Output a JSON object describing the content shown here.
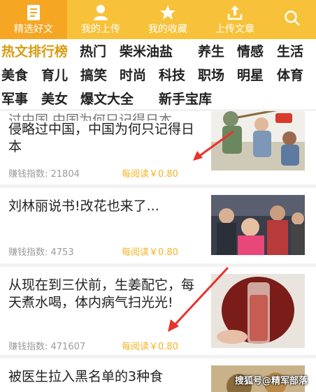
{
  "nav": {
    "items": [
      {
        "label": "精选好文",
        "icon": "article-icon",
        "active": true
      },
      {
        "label": "我的上传",
        "icon": "user-icon",
        "active": false
      },
      {
        "label": "我的收藏",
        "icon": "star-icon",
        "active": false
      },
      {
        "label": "上传文章",
        "icon": "upload-icon",
        "active": false
      },
      {
        "label": "",
        "icon": "search-icon",
        "active": false
      }
    ]
  },
  "categories": {
    "row1": [
      "热文排行榜",
      "热门",
      "柴米油盐",
      "养生",
      "情感",
      "生活"
    ],
    "row2": [
      "美食",
      "育儿",
      "搞笑",
      "时尚",
      "科技",
      "职场",
      "明星",
      "体育"
    ],
    "row3": [
      "军事",
      "美女",
      "爆文大全",
      "新手宝库"
    ]
  },
  "articles": [
    {
      "title_partial": "日本人有个疑问,那么多国家侵略过中国,中国为何只记得日本",
      "title_visible": "侵略过中国，中国为何只记得日本",
      "index_label": "赚钱指数: 21804",
      "reward_label": "每阅读￥0.80",
      "thumb": "war-cartoon-image"
    },
    {
      "title": "刘林丽说书!改花也来了...",
      "index_label": "赚钱指数: 4753",
      "reward_label": "每阅读￥0.80",
      "thumb": "crowd-photo-image"
    },
    {
      "title": "从现在到三伏前，生姜配它，每天煮水喝，体内病气扫光光!",
      "index_label": "赚钱指数: 471607",
      "reward_label": "每阅读￥0.80",
      "thumb": "ginger-drink-image"
    },
    {
      "title_visible": "被医生拉入黑名单的3种食",
      "thumb": "food-image"
    }
  ],
  "watermark": "搜狐号@精军部落",
  "colors": {
    "nav_bg": "#f7c23a",
    "nav_active": "#f5a623",
    "hot": "#d89c12",
    "reward": "#f5b223",
    "arrow": "#e8322c"
  }
}
